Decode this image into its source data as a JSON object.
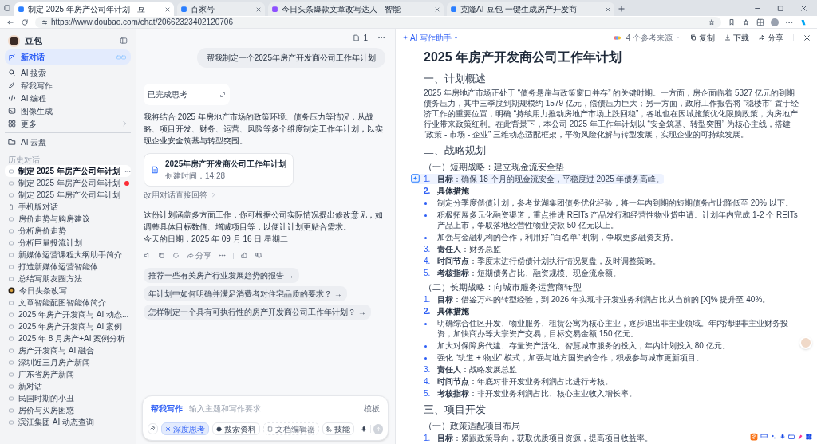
{
  "browser": {
    "tabs": [
      {
        "title": "制定 2025 年房产公司年计划 - 豆",
        "selected": true
      },
      {
        "title": "百家号",
        "selected": false
      },
      {
        "title": "今日头条爆款文章改写达人 - 智能",
        "selected": false
      },
      {
        "title": "克隆AI-豆包-一键生成房产开发商",
        "selected": false
      }
    ],
    "url": "https://www.doubao.com/chat/20662323402120706"
  },
  "sidebar": {
    "brand": "豆包",
    "nav": [
      {
        "label": "新对话",
        "selected": true,
        "kind": "link"
      },
      {
        "label": "AI 搜索",
        "selected": false,
        "kind": "link"
      },
      {
        "label": "帮我写作",
        "selected": false,
        "kind": "link"
      },
      {
        "label": "AI 编程",
        "selected": false,
        "kind": "link"
      },
      {
        "label": "图像生成",
        "selected": false,
        "kind": "link"
      },
      {
        "label": "更多",
        "selected": false,
        "kind": "submenu"
      }
    ],
    "cloud": "AI 云盘",
    "history_label": "历史对话",
    "history": [
      {
        "label": "制定 2025 年房产公司年计划",
        "kind": "chat",
        "selected": true,
        "unread": false
      },
      {
        "label": "制定 2025 年房产公司年计划",
        "kind": "chat",
        "selected": false,
        "unread": true
      },
      {
        "label": "制定 2025 年房产公司年计划",
        "kind": "chat",
        "selected": false,
        "unread": false
      },
      {
        "label": "手机版对话",
        "kind": "phone",
        "selected": false,
        "unread": false
      },
      {
        "label": "房价走势与购房建议",
        "kind": "chat",
        "selected": false,
        "unread": false
      },
      {
        "label": "分析房价走势",
        "kind": "chat",
        "selected": false,
        "unread": false
      },
      {
        "label": "分析巨量投流计划",
        "kind": "chat",
        "selected": false,
        "unread": false
      },
      {
        "label": "新媒体运营课程大纲助手简介",
        "kind": "chat",
        "selected": false,
        "unread": false
      },
      {
        "label": "打造新媒体运营智能体",
        "kind": "chat",
        "selected": false,
        "unread": false
      },
      {
        "label": "总结写朋友圈方法",
        "kind": "chat",
        "selected": false,
        "unread": false
      },
      {
        "label": "今日头条改写",
        "kind": "bot",
        "selected": false,
        "unread": false
      },
      {
        "label": "文章智能配图智能体简介",
        "kind": "chat",
        "selected": false,
        "unread": false
      },
      {
        "label": "2025 年房产开发商与 AI 动态...",
        "kind": "chat",
        "selected": false,
        "unread": false
      },
      {
        "label": "2025 年房产开发商与 AI 案例",
        "kind": "chat",
        "selected": false,
        "unread": false
      },
      {
        "label": "2025 年 8 月房产+AI 案例分析",
        "kind": "chat",
        "selected": false,
        "unread": false
      },
      {
        "label": "房产开发商与 AI 融合",
        "kind": "chat",
        "selected": false,
        "unread": false
      },
      {
        "label": "深圳近三月房产新闻",
        "kind": "chat",
        "selected": false,
        "unread": false
      },
      {
        "label": "广东省房产新闻",
        "kind": "chat",
        "selected": false,
        "unread": false
      },
      {
        "label": "新对话",
        "kind": "chat",
        "selected": false,
        "unread": false
      },
      {
        "label": "民国时期的小丑",
        "kind": "chat",
        "selected": false,
        "unread": false
      },
      {
        "label": "房价与买房困惑",
        "kind": "chat",
        "selected": false,
        "unread": false
      },
      {
        "label": "滨江集团 AI 动态查询",
        "kind": "chat",
        "selected": false,
        "unread": false
      }
    ]
  },
  "chat": {
    "doc_count": "1",
    "user_message": "帮我制定一个2025年房产开发商公司工作年计划",
    "thinking": "已完成思考",
    "intro": "我将结合 2025 年房地产市场的政策环境、债务压力等情况，从战略、项目开发、财务、运营、风险等多个维度制定工作年计划，以实现企业安全筑基与转型突围。",
    "doc_card": {
      "title": "2025年房产开发商公司工作年计划",
      "time": "创建时间：14:28"
    },
    "switch_link": "改用对话直接回答",
    "reply": "这份计划涵盖多方面工作，你可根据公司实际情况提出修改意见，如调整具体目标数值、增减项目等，以便让计划更贴合需求。",
    "date_line": "今天的日期：2025 年 09 月 16 日 星期二",
    "share": "分享",
    "suggestions": [
      "推荐一些有关房产行业发展趋势的报告 →",
      "年计划中如何明确并满足消费者对住宅品质的要求？ →",
      "怎样制定一个具有可执行性的房产开发商公司工作年计划？ →"
    ],
    "composer": {
      "mode": "帮我写作",
      "placeholder": "输入主题和写作要求",
      "template": "模板",
      "tools": [
        {
          "label": "深度思考",
          "selected": true,
          "disabled": false
        },
        {
          "label": "搜索资料",
          "selected": false,
          "disabled": false
        },
        {
          "label": "文档编辑器",
          "selected": false,
          "disabled": true
        },
        {
          "label": "技能",
          "selected": false,
          "disabled": false
        }
      ]
    }
  },
  "doc": {
    "assistant": "AI 写作助手",
    "sources": "4 个参考来源",
    "actions": [
      "复制",
      "下载",
      "分享"
    ],
    "blocks": [
      {
        "kind": "h1",
        "text": "2025 年房产开发商公司工作年计划"
      },
      {
        "kind": "h2",
        "text": "一、计划概述"
      },
      {
        "kind": "p",
        "text": "2025 年房地产市场正处于 “债务悬崖与政策窗口并存” 的关键时期。一方面，房企面临着 5327 亿元的到期债务压力，其中三季度到期规模约 1579 亿元，偿债压力巨大；另一方面，政府工作报告将 “稳楼市” 置于经济工作的重要位置，明确 “持续用力推动房地产市场止跌回稳”，各地也在因城施策优化限购政策，为房地产行业带来政策红利。在此背景下，本公司 2025 年工作年计划以 “安全筑基、转型突围” 为核心主线，搭建 “政策 - 市场 - 企业” 三维动态适配框架，平衡风险化解与转型发展，实现企业的可持续发展。"
      },
      {
        "kind": "h2",
        "text": "二、战略规划"
      },
      {
        "kind": "h3",
        "text": "（一）短期战略：建立现金流安全垫"
      },
      {
        "kind": "ol",
        "number": "1.",
        "text": "**目标**：确保 18 个月的现金流安全，平稳度过 2025 年债务高峰。",
        "strong": false,
        "focused": true
      },
      {
        "kind": "ol",
        "number": "2.",
        "text": "具体措施",
        "strong": true,
        "focused": false
      },
      {
        "kind": "bullet",
        "text": "制定分季度偿债计划，参考龙湖集团债务优化经验，将一年内到期的短期债务占比降低至 20% 以下。",
        "focused": false
      },
      {
        "kind": "bullet",
        "text": "积极拓展多元化融资渠道，重点推进 REITs 产品发行和经营性物业贷申请。计划年内完成 1-2 个 REITs 产品上市，争取落地经营性物业贷款 50 亿元以上。",
        "focused": false
      },
      {
        "kind": "bullet",
        "text": "加强与金融机构的合作，利用好 “白名单” 机制，争取更多融资支持。",
        "focused": false
      },
      {
        "kind": "ol",
        "number": "3.",
        "text": "**责任人**：财务总监",
        "strong": false,
        "focused": false
      },
      {
        "kind": "ol",
        "number": "4.",
        "text": "**时间节点**：季度末进行偿债计划执行情况复盘，及时调整策略。",
        "strong": false,
        "focused": false
      },
      {
        "kind": "ol",
        "number": "5.",
        "text": "**考核指标**：短期债务占比、融资规模、现金流余额。",
        "strong": false,
        "focused": false
      },
      {
        "kind": "h3",
        "text": "（二）长期战略：向城市服务运营商转型"
      },
      {
        "kind": "ol",
        "number": "1.",
        "text": "**目标**：借鉴万科的转型经验，到 2026 年实现非开发业务利润占比从当前的 [X]% 提升至 40%。",
        "strong": false,
        "focused": false
      },
      {
        "kind": "ol",
        "number": "2.",
        "text": "具体措施",
        "strong": true,
        "focused": false
      },
      {
        "kind": "bullet",
        "text": "明确综合住区开发、物业服务、租赁公寓为核心主业，逐步退出非主业领域。年内清理非主业财务投资，加快商办等大宗资产交易，目标交易金额 150 亿元。",
        "focused": false
      },
      {
        "kind": "bullet",
        "text": "加大对保障房代建、存量资产活化、智慧城市服务的投入，年内计划投入 80 亿元。",
        "focused": false
      },
      {
        "kind": "bullet",
        "text": "强化 “轨道 + 物业” 模式，加强与地方国资的合作，积极参与城市更新项目。",
        "focused": false
      },
      {
        "kind": "ol",
        "number": "3.",
        "text": "**责任人**：战略发展总监",
        "strong": false,
        "focused": false
      },
      {
        "kind": "ol",
        "number": "4.",
        "text": "**时间节点**：年底对非开发业务利润占比进行考核。",
        "strong": false,
        "focused": false
      },
      {
        "kind": "ol",
        "number": "5.",
        "text": "**考核指标**：非开发业务利润占比、核心主业收入增长率。",
        "strong": false,
        "focused": false
      },
      {
        "kind": "h2",
        "text": "三、项目开发"
      },
      {
        "kind": "h3",
        "text": "（一）政策适配项目布局"
      },
      {
        "kind": "ol",
        "number": "1.",
        "text": "**目标**：紧跟政策导向，获取优质项目资源，提高项目收益率。",
        "strong": false,
        "focused": false
      }
    ]
  },
  "ime": {
    "lang": "中"
  }
}
